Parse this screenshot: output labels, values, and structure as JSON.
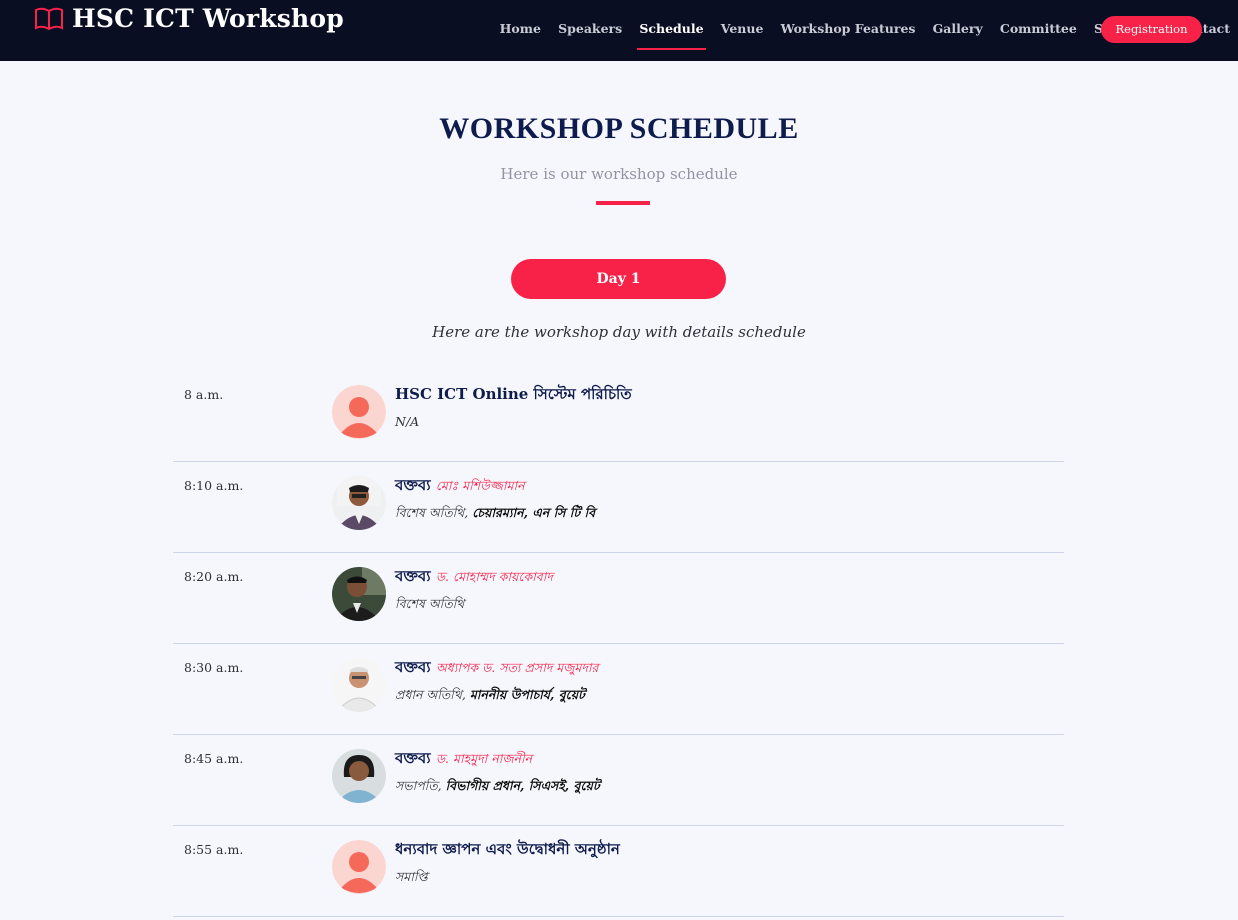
{
  "header": {
    "brand": "HSC ICT Workshop",
    "brand_icon": "book-icon",
    "nav": [
      "Home",
      "Speakers",
      "Schedule",
      "Venue",
      "Workshop Features",
      "Gallery",
      "Committee",
      "Sponsors",
      "Contact"
    ],
    "active_nav": "Schedule",
    "registration": "Registration"
  },
  "section": {
    "title": "WORKSHOP SCHEDULE",
    "subtitle": "Here is our workshop schedule",
    "day_tab": "Day 1",
    "day_description": "Here are the workshop day with details schedule"
  },
  "schedule": [
    {
      "time": "8 a.m.",
      "topic": "HSC ICT Online সিস্টেম পরিচিতি",
      "speaker": "",
      "role": "N/A",
      "role_bold": "",
      "avatar": "placeholder-icon"
    },
    {
      "time": "8:10 a.m.",
      "topic": "বক্তব্য",
      "speaker": "মোঃ মশিউজ্জামান",
      "role": "বিশেষ অতিথি,",
      "role_bold": "চেয়ারম্যান, এন সি টি বি",
      "avatar": "speaker-photo"
    },
    {
      "time": "8:20 a.m.",
      "topic": "বক্তব্য",
      "speaker": "ড. মোহাম্মদ কায়কোবাদ",
      "role": "বিশেষ অতিথি",
      "role_bold": "",
      "avatar": "speaker-photo"
    },
    {
      "time": "8:30 a.m.",
      "topic": "বক্তব্য",
      "speaker": "অধ্যাপক ড. সত্য প্রসাদ মজুমদার",
      "role": "প্রধান অতিথি,",
      "role_bold": "মাননীয় উপাচার্য, বুয়েট",
      "avatar": "speaker-photo"
    },
    {
      "time": "8:45 a.m.",
      "topic": "বক্তব্য",
      "speaker": "ড. মাহমুদা নাজনীন",
      "role": "সভাপতি,",
      "role_bold": "বিভাগীয় প্রধান, সিএসই, বুয়েট",
      "avatar": "speaker-photo"
    },
    {
      "time": "8:55 a.m.",
      "topic": "ধন্যবাদ জ্ঞাপন এবং উদ্বোধনী অনুষ্ঠান",
      "speaker": "",
      "role": "সমাপ্তি",
      "role_bold": "",
      "avatar": "placeholder-icon"
    }
  ],
  "colors": {
    "accent": "#f82249",
    "header_bg": "#0a0e22",
    "page_bg": "#f6f7fd",
    "title": "#0e1b4d"
  }
}
